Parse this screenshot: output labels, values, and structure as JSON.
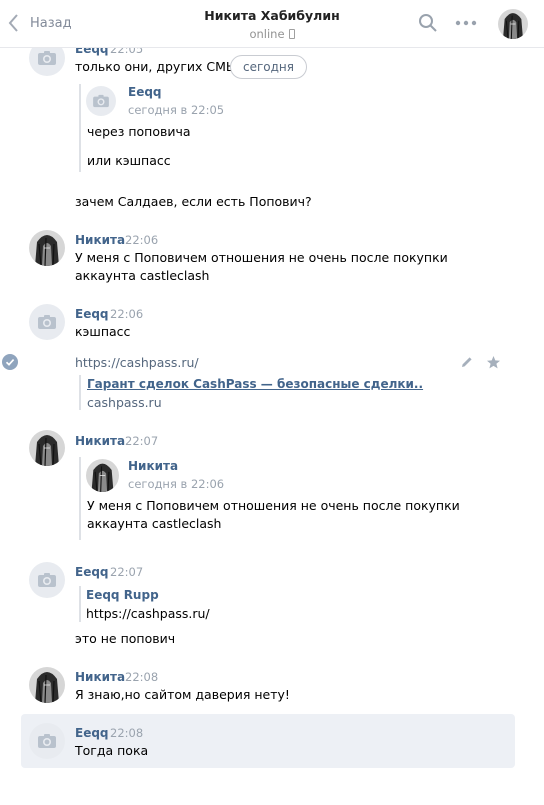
{
  "header": {
    "back_label": "Назад",
    "title": "Никита Хабибулин",
    "status": "online"
  },
  "date_divider": "сегодня",
  "messages": [
    {
      "author": "Eeqq",
      "time": "22:05",
      "text": "только они, других СМЫС",
      "quote": {
        "author": "Eeqq",
        "time": "сегодня в 22:05",
        "lines": [
          "через поповича",
          "или кэшпасс"
        ]
      },
      "after_quote": "зачем Салдаев, если есть Попович?"
    },
    {
      "author": "Никита",
      "time": "22:06",
      "lines": [
        "У меня с Поповичем отношения не очень после покупки",
        "аккаунта castleclash"
      ]
    },
    {
      "author": "Eeqq",
      "time": "22:06",
      "text": "кэшпасс",
      "link": {
        "url": "https://cashpass.ru/",
        "title": "Гарант сделок CashPass — безопасные сделки..",
        "host": "cashpass.ru"
      }
    },
    {
      "author": "Никита",
      "time": "22:07",
      "quote": {
        "author": "Никита",
        "time": "сегодня в 22:06",
        "lines": [
          "У меня с Поповичем отношения не очень после покупки",
          "аккаунта castleclash"
        ]
      }
    },
    {
      "author": "Eeqq",
      "time": "22:07",
      "quote": {
        "author": "Eeqq Rupp",
        "text": "https://cashpass.ru/"
      },
      "text": "это не попович"
    },
    {
      "author": "Никита",
      "time": "22:08",
      "text": "Я знаю,но сайтом даверия нету!"
    },
    {
      "author": "Eeqq",
      "time": "22:08",
      "text": "Тогда пока"
    }
  ],
  "icons": {
    "back": "chevron-left-icon",
    "search": "search-icon",
    "more": "more-icon",
    "camera": "camera-icon",
    "check": "check-icon",
    "edit": "pencil-icon",
    "favorite": "star-icon"
  },
  "colors": {
    "link_blue": "#42648b",
    "muted": "#828a99",
    "selected_bg": "#edf0f5"
  }
}
